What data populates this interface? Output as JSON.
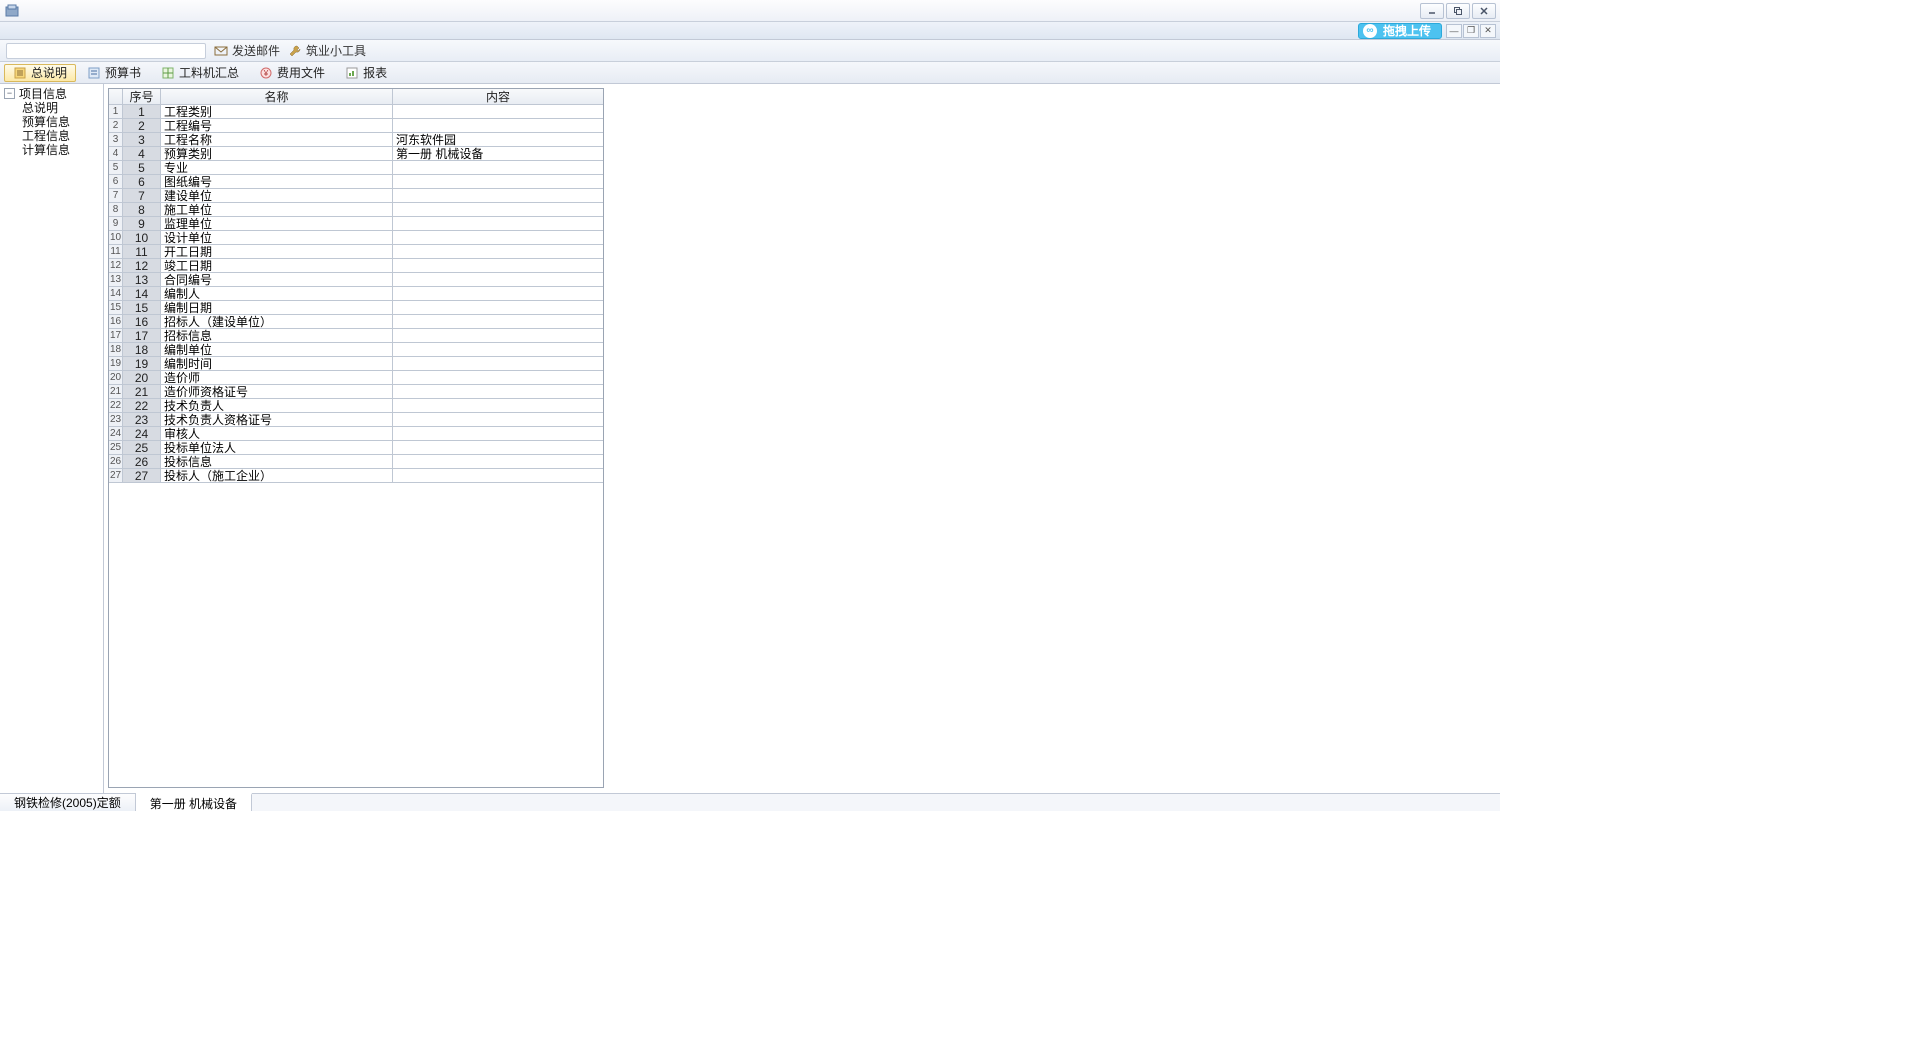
{
  "titlebar": {
    "app_name": ""
  },
  "cloud_upload": {
    "label": "拖拽上传"
  },
  "toolbar1": {
    "send_mail": "发送邮件",
    "small_tool": "筑业小工具"
  },
  "tabs": [
    {
      "label": "总说明",
      "active": true,
      "icon": "summary-icon"
    },
    {
      "label": "预算书",
      "active": false,
      "icon": "budget-icon"
    },
    {
      "label": "工料机汇总",
      "active": false,
      "icon": "materials-icon"
    },
    {
      "label": "费用文件",
      "active": false,
      "icon": "cost-icon"
    },
    {
      "label": "报表",
      "active": false,
      "icon": "report-icon"
    }
  ],
  "sidebar": {
    "root": "项目信息",
    "items": [
      "总说明",
      "预算信息",
      "工程信息",
      "计算信息"
    ]
  },
  "grid": {
    "headers": {
      "seq": "序号",
      "name": "名称",
      "content": "内容"
    },
    "rows": [
      {
        "seq": "1",
        "name": "工程类别",
        "content": ""
      },
      {
        "seq": "2",
        "name": "工程编号",
        "content": ""
      },
      {
        "seq": "3",
        "name": "工程名称",
        "content": "河东软件园"
      },
      {
        "seq": "4",
        "name": "预算类别",
        "content": "第一册  机械设备"
      },
      {
        "seq": "5",
        "name": "专业",
        "content": ""
      },
      {
        "seq": "6",
        "name": "图纸编号",
        "content": ""
      },
      {
        "seq": "7",
        "name": "建设单位",
        "content": ""
      },
      {
        "seq": "8",
        "name": "施工单位",
        "content": ""
      },
      {
        "seq": "9",
        "name": "监理单位",
        "content": ""
      },
      {
        "seq": "10",
        "name": "设计单位",
        "content": ""
      },
      {
        "seq": "11",
        "name": "开工日期",
        "content": ""
      },
      {
        "seq": "12",
        "name": "竣工日期",
        "content": ""
      },
      {
        "seq": "13",
        "name": "合同编号",
        "content": ""
      },
      {
        "seq": "14",
        "name": "编制人",
        "content": ""
      },
      {
        "seq": "15",
        "name": "编制日期",
        "content": ""
      },
      {
        "seq": "16",
        "name": "招标人（建设单位）",
        "content": ""
      },
      {
        "seq": "17",
        "name": "招标信息",
        "content": ""
      },
      {
        "seq": "18",
        "name": "编制单位",
        "content": ""
      },
      {
        "seq": "19",
        "name": "编制时间",
        "content": ""
      },
      {
        "seq": "20",
        "name": "造价师",
        "content": ""
      },
      {
        "seq": "21",
        "name": "造价师资格证号",
        "content": ""
      },
      {
        "seq": "22",
        "name": "技术负责人",
        "content": ""
      },
      {
        "seq": "23",
        "name": "技术负责人资格证号",
        "content": ""
      },
      {
        "seq": "24",
        "name": "审核人",
        "content": ""
      },
      {
        "seq": "25",
        "name": "投标单位法人",
        "content": ""
      },
      {
        "seq": "26",
        "name": "投标信息",
        "content": ""
      },
      {
        "seq": "27",
        "name": "投标人（施工企业）",
        "content": ""
      }
    ]
  },
  "statusbar": {
    "tabs": [
      "钢铁检修(2005)定额",
      "第一册 机械设备"
    ]
  }
}
